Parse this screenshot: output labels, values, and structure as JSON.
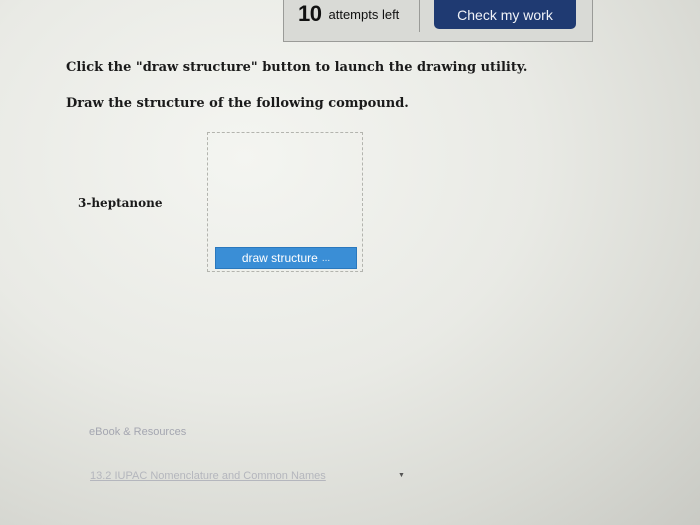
{
  "header": {
    "attempts_count": "10",
    "attempts_label": "attempts left",
    "check_button_label": "Check my work"
  },
  "question": {
    "instruction_1": "Click the \"draw structure\" button to launch the drawing utility.",
    "instruction_2": "Draw the structure of the following compound.",
    "compound_name": "3-heptanone",
    "draw_button_label": "draw structure",
    "draw_button_ellipsis": "..."
  },
  "resources": {
    "section_label": "eBook & Resources",
    "link_label": "13.2 IUPAC Nomenclature and Common Names"
  },
  "colors": {
    "check_button_bg": "#1f3a72",
    "draw_button_bg": "#3a8ed6"
  }
}
